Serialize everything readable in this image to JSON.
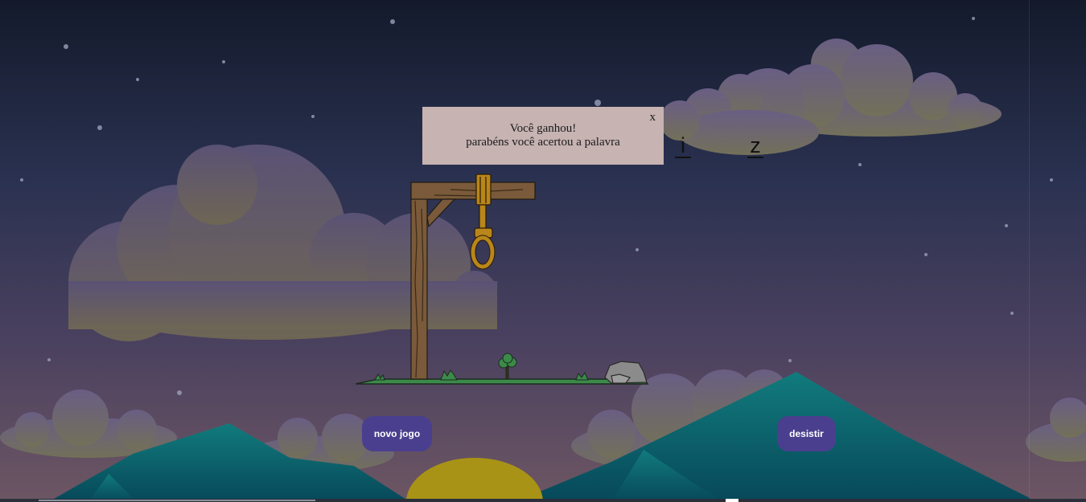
{
  "modal": {
    "close_label": "x",
    "title": "Você ganhou!",
    "message": "parabéns você acertou a palavra"
  },
  "word": {
    "letters": [
      "i",
      "z"
    ]
  },
  "buttons": {
    "new_game": "novo jogo",
    "give_up": "desistir"
  },
  "colors": {
    "sky_top": "#141a2c",
    "sky_bottom": "#6b5561",
    "button_bg": "#4a3f8e",
    "modal_bg": "#c6b3b2",
    "mountain": "#0e6e74",
    "sun": "#b39a18"
  }
}
